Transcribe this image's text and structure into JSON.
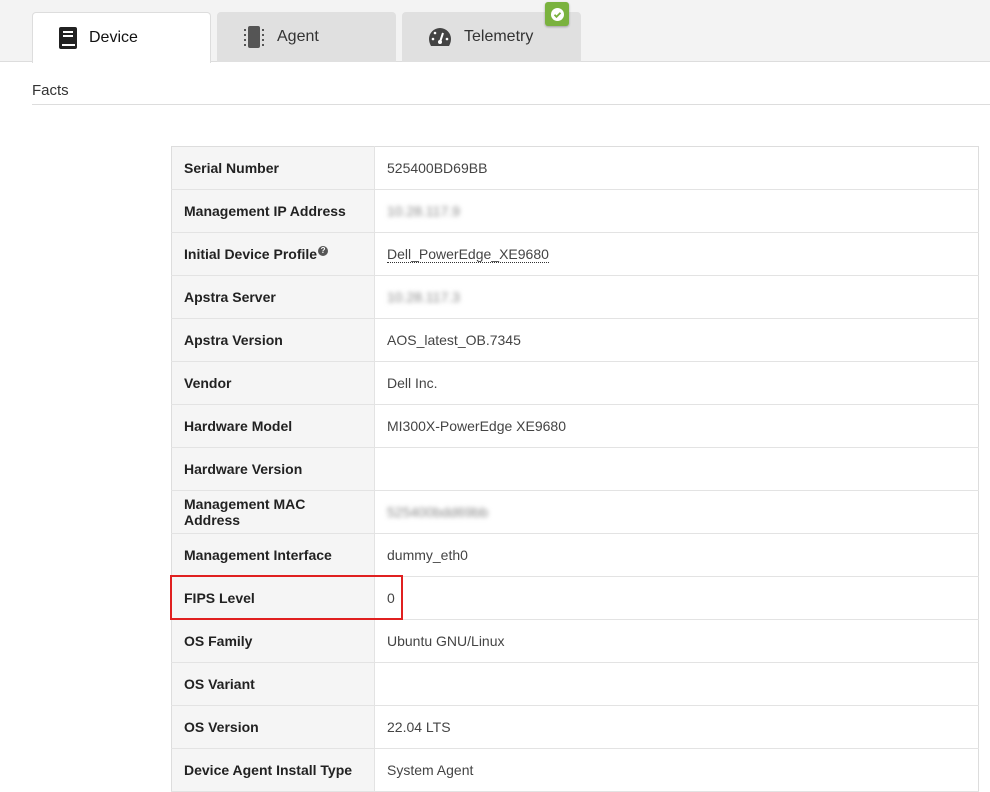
{
  "tabs": [
    {
      "label": "Device",
      "icon": "book-icon"
    },
    {
      "label": "Agent",
      "icon": "chip-icon"
    },
    {
      "label": "Telemetry",
      "icon": "gauge-icon"
    }
  ],
  "section_title": "Facts",
  "facts": [
    {
      "label": "Serial Number",
      "value": "525400BD69BB"
    },
    {
      "label": "Management IP Address",
      "value": "10.28.117.9",
      "blurred": true
    },
    {
      "label": "Initial Device Profile",
      "value": "Dell_PowerEdge_XE9680",
      "link": true,
      "help": "?"
    },
    {
      "label": "Apstra Server",
      "value": "10.28.117.3",
      "blurred": true
    },
    {
      "label": "Apstra Version",
      "value": "AOS_latest_OB.7345"
    },
    {
      "label": "Vendor",
      "value": "Dell Inc."
    },
    {
      "label": "Hardware Model",
      "value": "MI300X-PowerEdge XE9680"
    },
    {
      "label": "Hardware Version",
      "value": ""
    },
    {
      "label": "Management MAC Address",
      "value": "525400bdd69bb",
      "blurred": true
    },
    {
      "label": "Management Interface",
      "value": "dummy_eth0"
    },
    {
      "label": "FIPS Level",
      "value": "0"
    },
    {
      "label": "OS Family",
      "value": "Ubuntu GNU/Linux"
    },
    {
      "label": "OS Variant",
      "value": ""
    },
    {
      "label": "OS Version",
      "value": "22.04 LTS"
    },
    {
      "label": "Device Agent Install Type",
      "value": "System Agent"
    }
  ]
}
